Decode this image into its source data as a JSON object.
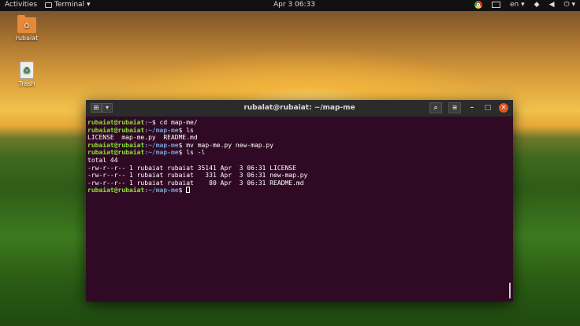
{
  "topbar": {
    "activities": "Activities",
    "app_name": "Terminal",
    "clock": "Apr 3  06:33",
    "lang": "en",
    "icons": [
      "chrome-icon",
      "screen-icon",
      "wifi-icon",
      "volume-icon",
      "power-icon"
    ]
  },
  "desktop": {
    "home_label": "rubaiat",
    "trash_label": "Trash"
  },
  "window": {
    "title": "rubalat@rubaiat: ~/map-me",
    "search_icon": "search-icon",
    "menu_icon": "hamburger-icon"
  },
  "terminal": {
    "lines": [
      {
        "user": "rubaiat@rubaiat",
        "path": ":~",
        "cmd": "$ cd map-me/"
      },
      {
        "user": "rubaiat@rubaiat",
        "path": ":~/map-me",
        "cmd": "$ ls"
      },
      {
        "output": "LICENSE  map-me.py  README.md"
      },
      {
        "user": "rubaiat@rubaiat",
        "path": ":~/map-me",
        "cmd": "$ mv map-me.py new-map.py"
      },
      {
        "user": "rubaiat@rubaiat",
        "path": ":~/map-me",
        "cmd": "$ ls -l"
      },
      {
        "output": "total 44"
      },
      {
        "output": "-rw-r--r-- 1 rubaiat rubaiat 35141 Apr  3 06:31 LICENSE"
      },
      {
        "output": "-rw-r--r-- 1 rubaiat rubaiat   331 Apr  3 06:31 new-map.py"
      },
      {
        "output": "-rw-r--r-- 1 rubaiat rubaiat    80 Apr  3 06:31 README.md"
      },
      {
        "user": "rubaiat@rubaiat",
        "path": ":~/map-me",
        "cmd": "$ ",
        "cursor": true
      }
    ]
  },
  "colors": {
    "terminal_bg": "#300a24",
    "user": "#8ae234",
    "path": "#729fcf",
    "close": "#e95420"
  }
}
